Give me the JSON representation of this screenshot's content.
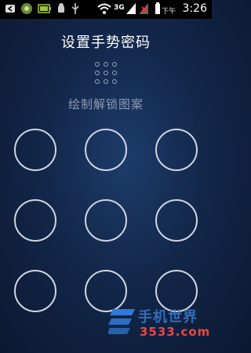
{
  "status_bar": {
    "network": "3G",
    "ampm": "下午",
    "time": "3:26",
    "icons": [
      "back-icon",
      "android-icon",
      "battery-charging-icon",
      "usb-icon",
      "wifi-icon",
      "signal-3g-icon",
      "signal-no-sim-icon",
      "battery-icon"
    ]
  },
  "screen": {
    "title": "设置手势密码",
    "hint": "绘制解锁图案"
  },
  "pattern": {
    "rows": 3,
    "cols": 3,
    "ring_color": "#cfd6e2"
  },
  "watermark": {
    "logo_text": "手机世界",
    "site": "3533.com"
  }
}
